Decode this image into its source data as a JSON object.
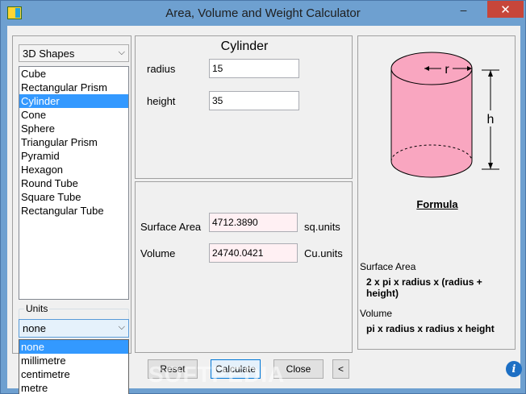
{
  "window": {
    "title": "Area, Volume and Weight Calculator",
    "minimize": "–",
    "maximize": "",
    "close": "✕"
  },
  "shapes": {
    "category": "3D Shapes",
    "items": [
      "Cube",
      "Rectangular Prism",
      "Cylinder",
      "Cone",
      "Sphere",
      "Triangular Prism",
      "Pyramid",
      "Hexagon",
      "Round Tube",
      "Square Tube",
      "Rectangular Tube"
    ],
    "selected_index": 2
  },
  "units": {
    "legend": "Units",
    "selected": "none",
    "options": [
      "none",
      "millimetre",
      "centimetre",
      "metre"
    ]
  },
  "inputs": {
    "shape_name": "Cylinder",
    "radius_label": "radius",
    "radius_value": "15",
    "height_label": "height",
    "height_value": "35"
  },
  "results": {
    "surface_area_label": "Surface Area",
    "surface_area_value": "4712.3890",
    "surface_area_unit": "sq.units",
    "volume_label": "Volume",
    "volume_value": "24740.0421",
    "volume_unit": "Cu.units"
  },
  "diagram": {
    "r_label": "r",
    "h_label": "h",
    "fill_color": "#f9a6c0"
  },
  "formula": {
    "heading": "Formula",
    "surface_area_label": "Surface Area",
    "surface_area_formula": "2 x pi x radius x (radius + height)",
    "volume_label": "Volume",
    "volume_formula": "pi x radius x radius x height"
  },
  "buttons": {
    "reset": "Reset",
    "calculate": "Calculate",
    "close": "Close",
    "back": "<"
  },
  "watermark": "SOFTPEDIA",
  "colors": {
    "selection": "#3399ff",
    "titlebar": "#6ea0d0",
    "close_button": "#c7463a"
  }
}
